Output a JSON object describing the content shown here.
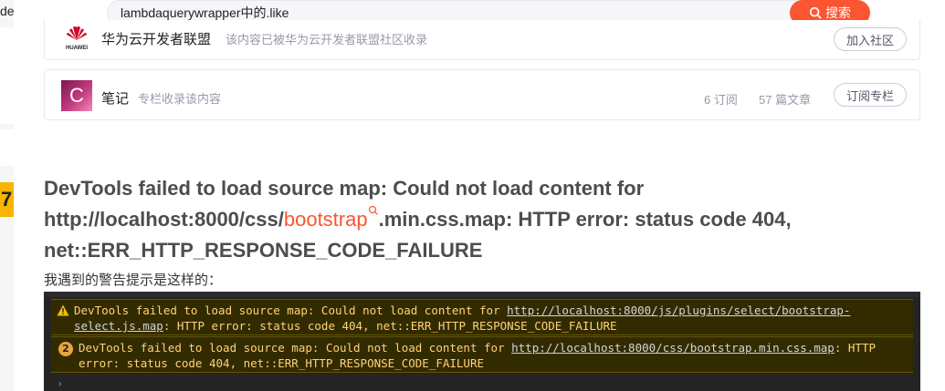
{
  "left": {
    "text": "de",
    "badge": "7"
  },
  "search": {
    "value": "lambdaquerywrapper中的.like",
    "button": "搜索"
  },
  "community": {
    "huawei": {
      "logo_text": "HUAWEI",
      "title": "华为云开发者联盟",
      "desc": "该内容已被华为云开发者联盟社区收录",
      "button": "加入社区"
    },
    "column": {
      "avatar": "C",
      "title": "笔记",
      "desc": "专栏收录该内容",
      "subscribers": "6 订阅",
      "articles": "57 篇文章",
      "button": "订阅专栏"
    }
  },
  "article": {
    "heading_part1": "DevTools failed to load source map: Could not load content for http://localhost:8000/css/",
    "heading_keyword": "bootstrap",
    "heading_part2": ".min.css.map: HTTP error: status code 404, net::ERR_HTTP_RESPONSE_CODE_FAILURE",
    "intro": "我遇到的警告提示是这样的："
  },
  "console": {
    "msg1_prefix": "DevTools failed to load source map: Could not load content for ",
    "msg1_link": "http://localhost:8000/js/plugins/select/bootstrap-select.js.map",
    "msg1_suffix": ": HTTP error: status code 404, net::ERR_HTTP_RESPONSE_CODE_FAILURE",
    "msg2_count": "2",
    "msg2_prefix": "DevTools failed to load source map: Could not load content for ",
    "msg2_link": "http://localhost:8000/css/bootstrap.min.css.map",
    "msg2_suffix": ": HTTP error: status code 404, net::ERR_HTTP_RESPONSE_CODE_FAILURE",
    "prompt": "›"
  },
  "colors": {
    "accent": "#fc5531",
    "warning_bg": "#332b00",
    "warning_text": "#ffd27a",
    "console_bg": "#242424"
  },
  "icons": [
    "search-icon",
    "huawei-logo-icon",
    "keyword-search-icon",
    "warning-icon"
  ]
}
